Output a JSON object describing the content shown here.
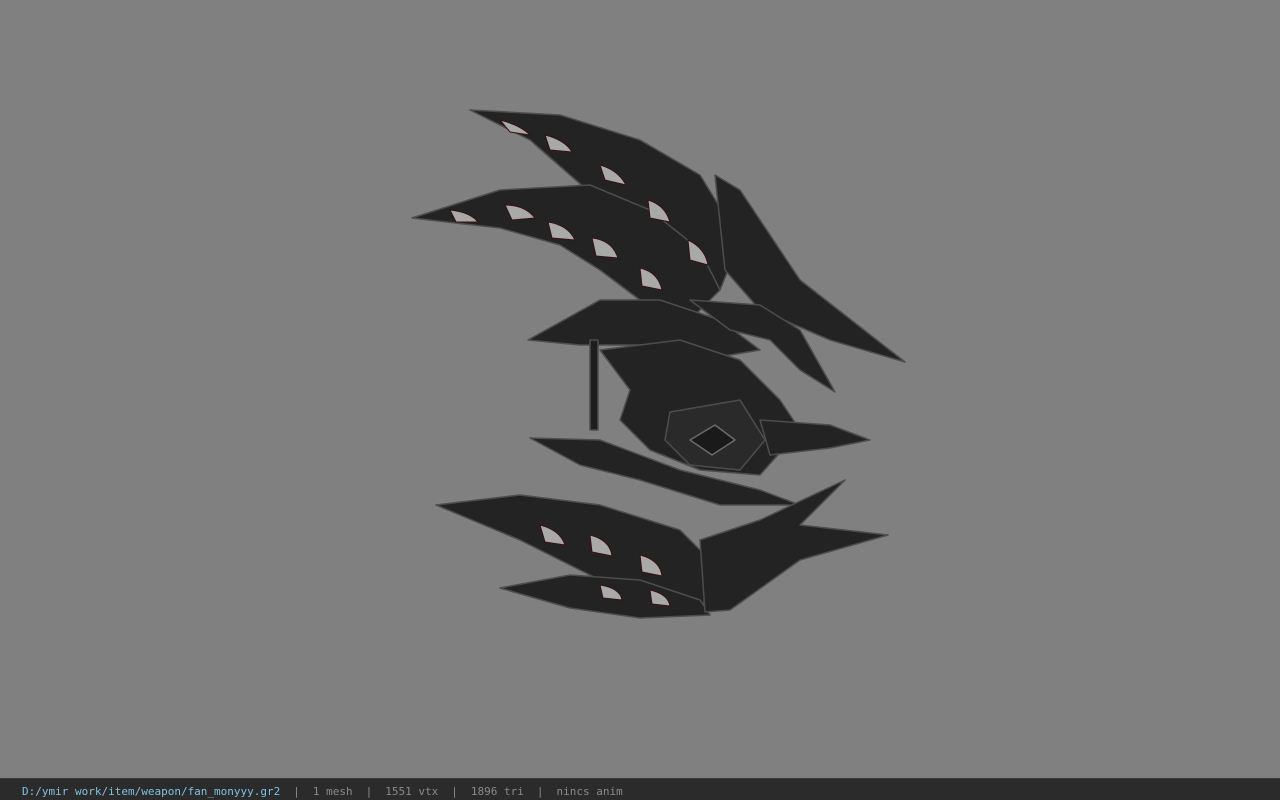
{
  "viewport": {
    "background": "#808080",
    "model_color": "#242424",
    "edge_color": "#4a4a4a",
    "hole_color": "#a8a8a8"
  },
  "statusbar": {
    "file_path": "D:/ymir work/item/weapon/fan_monyyy.gr2",
    "separator": "|",
    "mesh_count": "1 mesh",
    "vertex_count": "1551 vtx",
    "triangle_count": "1896 tri",
    "anim_status": "nincs anim",
    "path_color": "#7fc0e0",
    "text_color": "#8a8a8a"
  }
}
